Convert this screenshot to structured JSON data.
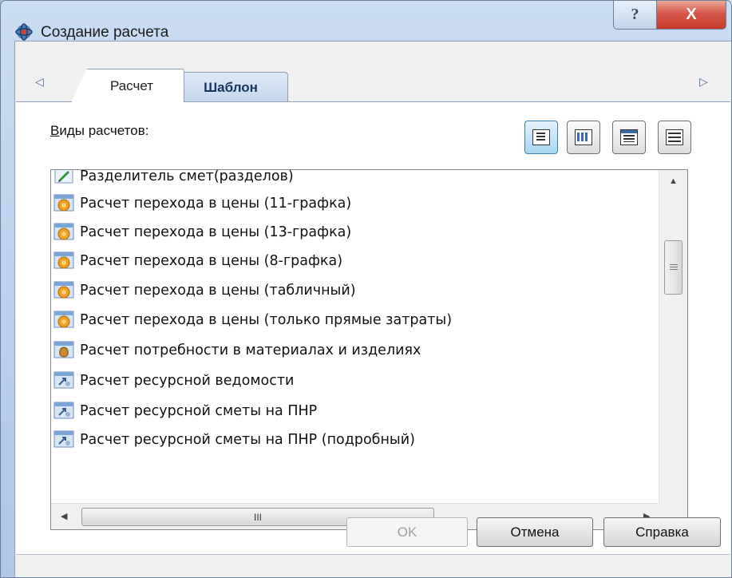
{
  "window": {
    "title": "Создание расчета",
    "help_glyph": "?",
    "close_glyph": "X"
  },
  "tabs": {
    "left_arrow": "◁",
    "right_arrow": "▷",
    "items": [
      {
        "label": "Расчет",
        "selected": true
      },
      {
        "label": "Шаблон",
        "selected": false
      }
    ]
  },
  "list": {
    "label": "Виды расчетов:",
    "items": [
      {
        "label": "Разделитель смет(разделов)",
        "icon": "pencil-icon"
      },
      {
        "label": "Расчет перехода в цены (11-графка)",
        "icon": "coin-icon"
      },
      {
        "label": "Расчет перехода в цены (13-графка)",
        "icon": "coin-icon"
      },
      {
        "label": "Расчет перехода в цены (8-графка)",
        "icon": "coin-icon"
      },
      {
        "label": "Расчет перехода в цены (табличный)",
        "icon": "coin-icon"
      },
      {
        "label": "Расчет перехода в цены (только прямые затраты)",
        "icon": "coin-icon"
      },
      {
        "label": "Расчет потребности в материалах и изделиях",
        "icon": "money-bag-icon"
      },
      {
        "label": "Расчет ресурсной ведомости",
        "icon": "resource-icon"
      },
      {
        "label": "Расчет ресурсной сметы на ПНР",
        "icon": "resource-icon"
      },
      {
        "label": "Расчет ресурсной сметы на ПНР (подробный)",
        "icon": "resource-icon"
      }
    ],
    "vscroll_position": 0.33,
    "hscroll_thumb_glyph": "III"
  },
  "view_buttons": [
    {
      "name": "view-list-icon",
      "active": true
    },
    {
      "name": "view-small-icons-icon",
      "active": false
    },
    {
      "name": "view-details-icon",
      "active": false
    },
    {
      "name": "view-tiles-icon",
      "active": false
    }
  ],
  "buttons": {
    "ok": "OK",
    "cancel": "Отмена",
    "help": "Справка"
  },
  "colors": {
    "selected_view_button": "#a6d5f2",
    "close_button": "#c43c2c",
    "coin": "#f0a020"
  }
}
